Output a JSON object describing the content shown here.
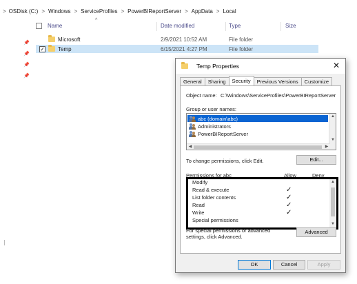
{
  "breadcrumb": {
    "lead": ">",
    "items": [
      "OSDisk (C:)",
      "Windows",
      "ServiceProfiles",
      "PowerBIReportServer",
      "AppData",
      "Local"
    ],
    "separator": ">"
  },
  "columns": {
    "name": "Name",
    "date": "Date modified",
    "type": "Type",
    "size": "Size",
    "sort_glyph": "^"
  },
  "files": [
    {
      "name": "Microsoft",
      "date": "2/9/2021 10:52 AM",
      "type": "File folder",
      "selected": false
    },
    {
      "name": "Temp",
      "date": "6/15/2021 4:27 PM",
      "type": "File folder",
      "selected": true
    }
  ],
  "dialog": {
    "title": "Temp Properties",
    "close_glyph": "✕",
    "tabs": [
      "General",
      "Sharing",
      "Security",
      "Previous Versions",
      "Customize"
    ],
    "active_tab": "Security",
    "object_label": "Object name:",
    "object_value": "C:\\Windows\\ServiceProfiles\\PowerBIReportServer",
    "group_label": "Group or user names:",
    "users": [
      "abc (domain\\abc)",
      "Administrators",
      "PowerBIReportServer"
    ],
    "change_text": "To change permissions, click Edit.",
    "edit_button": "Edit...",
    "permissions_label": "Permissions for abc",
    "allow_label": "Allow",
    "deny_label": "Deny",
    "permissions": [
      {
        "name": "Modify",
        "allow": false
      },
      {
        "name": "Read & execute",
        "allow": true
      },
      {
        "name": "List folder contents",
        "allow": true
      },
      {
        "name": "Read",
        "allow": true
      },
      {
        "name": "Write",
        "allow": true
      },
      {
        "name": "Special permissions",
        "allow": false
      }
    ],
    "check_glyph": "✓",
    "special_text": "For special permissions or advanced settings, click Advanced.",
    "advanced_button": "Advanced",
    "ok_button": "OK",
    "cancel_button": "Cancel",
    "apply_button": "Apply"
  },
  "colors": {
    "selection": "#cce4f7",
    "list_selection": "#0a64d2",
    "folder": "#f5cf6b",
    "dialog_bg": "#f0f0f0"
  },
  "icons": [
    "folder-icon",
    "pin-icon",
    "user-group-icon",
    "close-icon",
    "scroll-arrow-icon",
    "checkmark-icon"
  ]
}
